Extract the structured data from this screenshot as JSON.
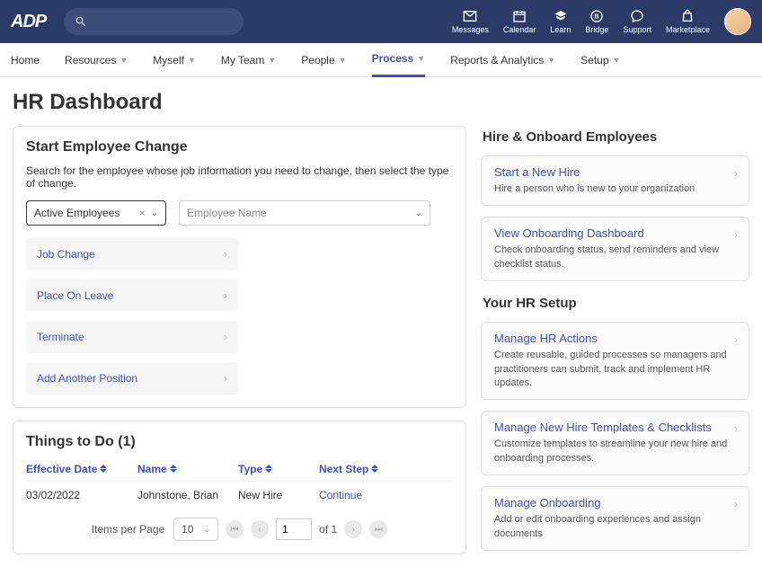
{
  "top": {
    "logo": "ADP",
    "items": [
      {
        "label": "Messages",
        "icon": "mail"
      },
      {
        "label": "Calendar",
        "icon": "calendar"
      },
      {
        "label": "Learn",
        "icon": "grad"
      },
      {
        "label": "Bridge",
        "icon": "bridge"
      },
      {
        "label": "Support",
        "icon": "chat"
      },
      {
        "label": "Marketplace",
        "icon": "bag"
      }
    ]
  },
  "nav": [
    {
      "label": "Home",
      "dropdown": false,
      "active": false
    },
    {
      "label": "Resources",
      "dropdown": true,
      "active": false
    },
    {
      "label": "Myself",
      "dropdown": true,
      "active": false
    },
    {
      "label": "My Team",
      "dropdown": true,
      "active": false
    },
    {
      "label": "People",
      "dropdown": true,
      "active": false
    },
    {
      "label": "Process",
      "dropdown": true,
      "active": true
    },
    {
      "label": "Reports & Analytics",
      "dropdown": true,
      "active": false
    },
    {
      "label": "Setup",
      "dropdown": true,
      "active": false
    }
  ],
  "page_title": "HR Dashboard",
  "start_change": {
    "title": "Start Employee Change",
    "help": "Search for the employee whose job information you need to change, then select the type of change.",
    "filter_value": "Active Employees",
    "name_placeholder": "Employee Name",
    "actions": [
      "Job Change",
      "Place On Leave",
      "Terminate",
      "Add Another Position"
    ]
  },
  "todo": {
    "title": "Things to Do (1)",
    "cols": [
      "Effective Date",
      "Name",
      "Type",
      "Next Step"
    ],
    "row": {
      "date": "03/02/2022",
      "name": "Johnstone, Brian",
      "type": "New Hire",
      "next": "Continue"
    },
    "pager": {
      "label": "Items per Page",
      "per_page": "10",
      "page": "1",
      "of": "of 1"
    }
  },
  "hire": {
    "title": "Hire & Onboard Employees",
    "cards": [
      {
        "title": "Start a New Hire",
        "desc": "Hire a person who is new to your organization"
      },
      {
        "title": "View Onboarding Dashboard",
        "desc": "Check onboarding status, send reminders and view checklist status."
      }
    ]
  },
  "setup": {
    "title": "Your HR Setup",
    "cards": [
      {
        "title": "Manage HR Actions",
        "desc": "Create reusable, guided processes so managers and practitioners can submit, track and implement HR updates."
      },
      {
        "title": "Manage New Hire Templates & Checklists",
        "desc": "Customize templates to streamline your new hire and onboarding processes."
      },
      {
        "title": "Manage Onboarding",
        "desc": "Add or edit onboarding experiences and assign documents"
      }
    ]
  }
}
